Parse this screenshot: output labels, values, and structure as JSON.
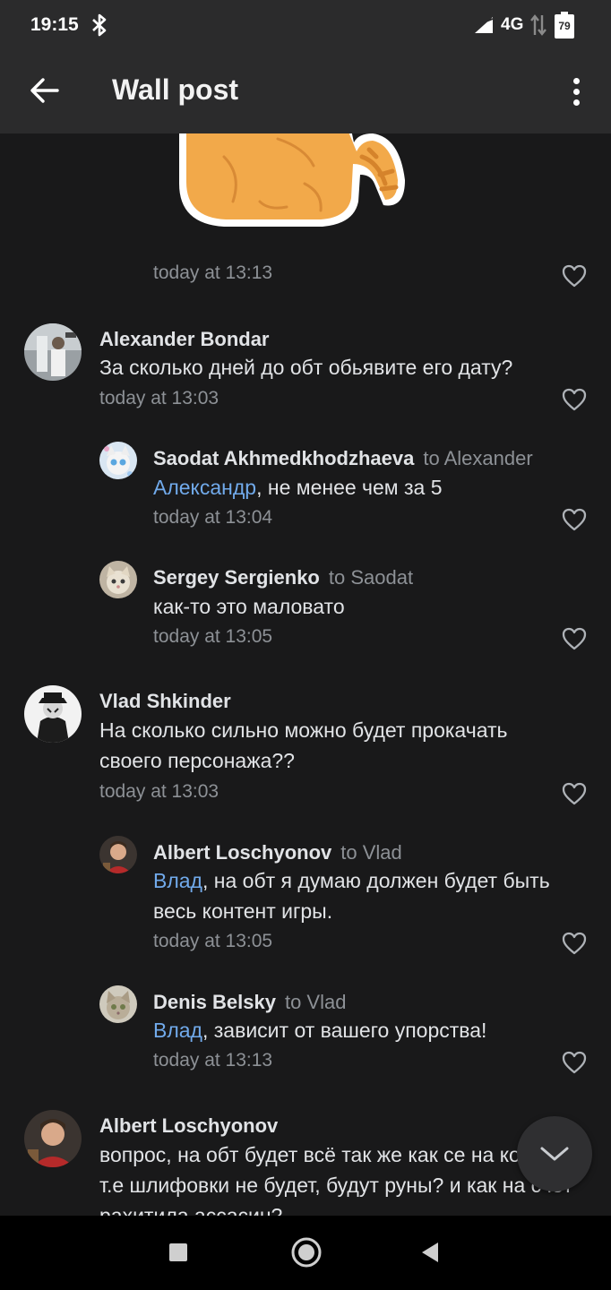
{
  "status_bar": {
    "time": "19:15",
    "network": "4G",
    "battery": "79"
  },
  "app_bar": {
    "title": "Wall post"
  },
  "sticker_comment": {
    "time": "today at 13:13"
  },
  "comments": [
    {
      "author": "Alexander Bondar",
      "reply_to": "",
      "mention": "",
      "text": "За сколько дней до обт обьявите его дату?",
      "time": "today at 13:03"
    },
    {
      "author": "Saodat Akhmedkhodzhaeva",
      "reply_to": "to Alexander",
      "mention": "Александр",
      "text": ", не менее чем за 5",
      "time": "today at 13:04"
    },
    {
      "author": "Sergey Sergienko",
      "reply_to": "to Saodat",
      "mention": "",
      "text": "как-то это маловато",
      "time": "today at 13:05"
    },
    {
      "author": "Vlad Shkinder",
      "reply_to": "",
      "mention": "",
      "text": "На сколько сильно можно будет прокачать своего персонажа??",
      "time": "today at 13:03"
    },
    {
      "author": "Albert Loschyonov",
      "reply_to": "to Vlad",
      "mention": "Влад",
      "text": ", на обт я думаю должен будет быть весь контент игры.",
      "time": "today at 13:05"
    },
    {
      "author": "Denis Belsky",
      "reply_to": "to Vlad",
      "mention": "Влад",
      "text": ", зависит от вашего упорства!",
      "time": "today at 13:13"
    },
    {
      "author": "Albert Loschyonov",
      "reply_to": "",
      "mention": "",
      "text": "вопрос, на обт будет всё так же как се на корее, т.е шлифовки не будет, будут руны? и как на счёт рахитила ассасин?",
      "time": ""
    }
  ]
}
